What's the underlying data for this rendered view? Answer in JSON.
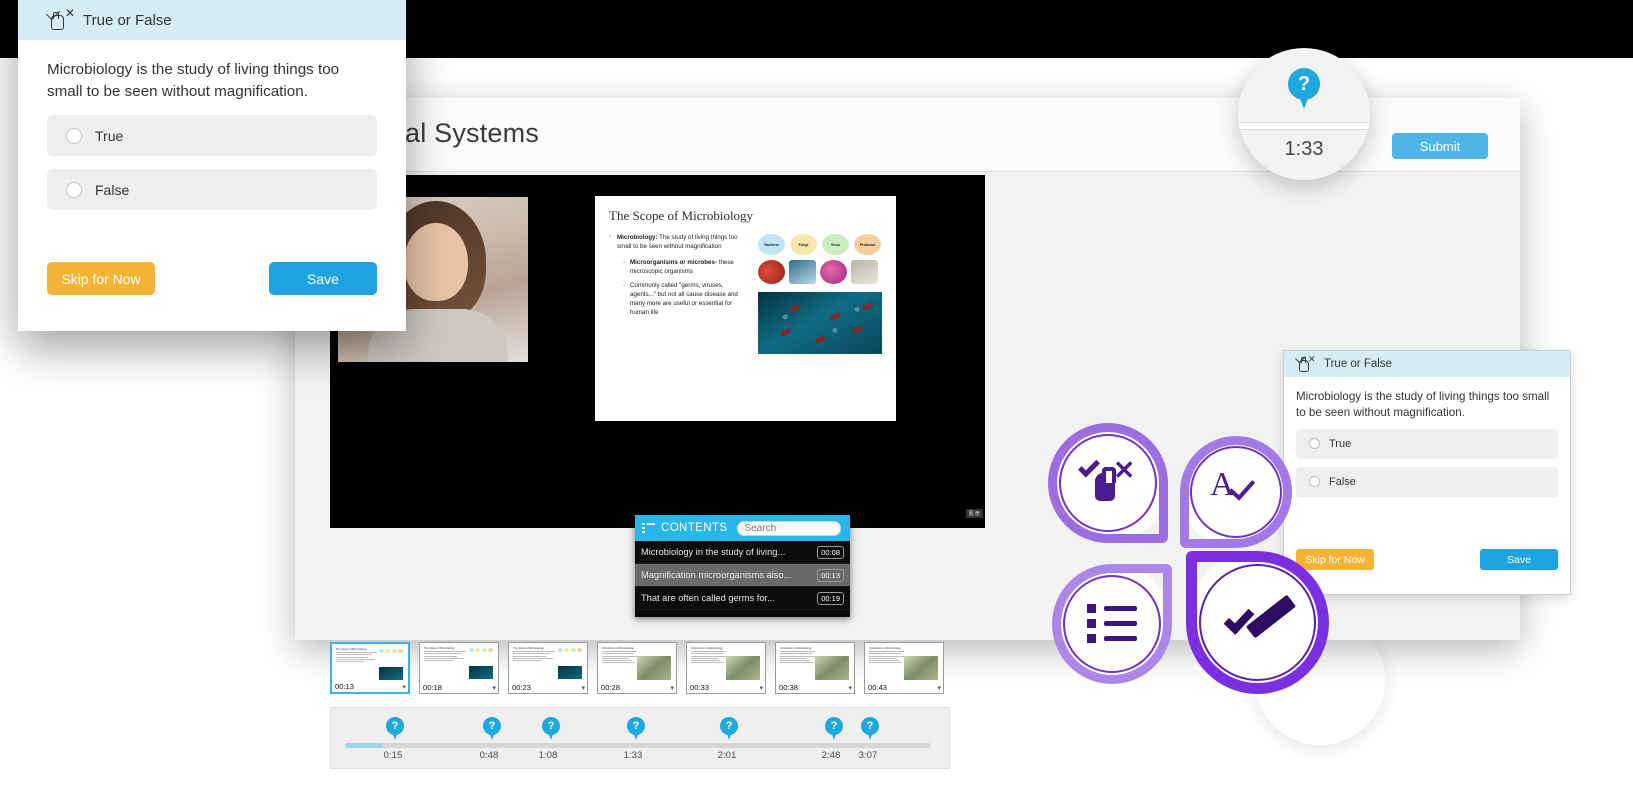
{
  "browser": {
    "title": "al Systems",
    "submit_label": "Submit"
  },
  "slide": {
    "title": "The Scope of Microbiology",
    "bullets": [
      {
        "level": 1,
        "bold": "Microbiology:",
        "text": " The study of living things too small to be seen without magnification"
      },
      {
        "level": 2,
        "bold": "Microorganisms or microbes-",
        "text": " these microscopic organisms"
      },
      {
        "level": 2,
        "bold": "",
        "text": "Commonly called \"germs, viruses, agents...\" but not all cause disease and many more are useful or essential for human life"
      }
    ],
    "chips": [
      {
        "label": "Bacteria",
        "color": "#bfe6f2"
      },
      {
        "label": "Fungi",
        "color": "#f6e9a8"
      },
      {
        "label": "Virus",
        "color": "#ccedbe"
      },
      {
        "label": "Protozoa",
        "color": "#f5cf9c"
      }
    ],
    "corner_badge": "图 册"
  },
  "contents": {
    "title": "CONTENTS",
    "search_placeholder": "Search",
    "items": [
      {
        "text": "Microbiology in the study of living...",
        "time": "00:08",
        "active": false
      },
      {
        "text": "Magnification microorganisms also...",
        "time": "00:13",
        "active": true
      },
      {
        "text": "That are often called germs for...",
        "time": "00:19",
        "active": false
      }
    ]
  },
  "thumbnails": [
    {
      "time": "00:13",
      "selected": true,
      "variant": "micro"
    },
    {
      "time": "00:18",
      "selected": false,
      "variant": "micro"
    },
    {
      "time": "00:23",
      "selected": false,
      "variant": "micro"
    },
    {
      "time": "00:28",
      "selected": false,
      "variant": "alt"
    },
    {
      "time": "00:33",
      "selected": false,
      "variant": "alt"
    },
    {
      "time": "00:38",
      "selected": false,
      "variant": "alt"
    },
    {
      "time": "00:43",
      "selected": false,
      "variant": "alt"
    }
  ],
  "timeline": {
    "markers": [
      {
        "label": "0:15",
        "x_pct": 10.5
      },
      {
        "label": "0:48",
        "x_pct": 26.5
      },
      {
        "label": "1:08",
        "x_pct": 36.0
      },
      {
        "label": "1:33",
        "x_pct": 50.0
      },
      {
        "label": "2:01",
        "x_pct": 65.0
      },
      {
        "label": "2:48",
        "x_pct": 82.5
      },
      {
        "label": "3:07",
        "x_pct": 88.5
      }
    ],
    "progress_pct": 6.5
  },
  "magnifier": {
    "pin_icon": "question-pin-icon",
    "time_label": "1:33"
  },
  "quiz": {
    "type_label": "True or False",
    "question": "Microbiology is the study of living things too small to be seen without magnification.",
    "options": [
      {
        "label": "True",
        "selected": false
      },
      {
        "label": "False",
        "selected": false
      }
    ],
    "skip_label": "Skip for Now",
    "save_label": "Save"
  },
  "feature_icons": [
    {
      "name": "true-false-icon",
      "glyph": "check-x-hand"
    },
    {
      "name": "fill-in-blank-icon",
      "glyph": "a-check"
    },
    {
      "name": "multiple-choice-icon",
      "glyph": "bulleted-list"
    },
    {
      "name": "survey-icon",
      "glyph": "bold-check"
    }
  ],
  "colors": {
    "accent_blue": "#1fa3e0",
    "header_blue": "#d6ecf7",
    "contents_blue": "#29b6e8",
    "skip_orange": "#f5b335",
    "purple": "#7b2fe0",
    "purple_dark": "#4a1d8f"
  }
}
